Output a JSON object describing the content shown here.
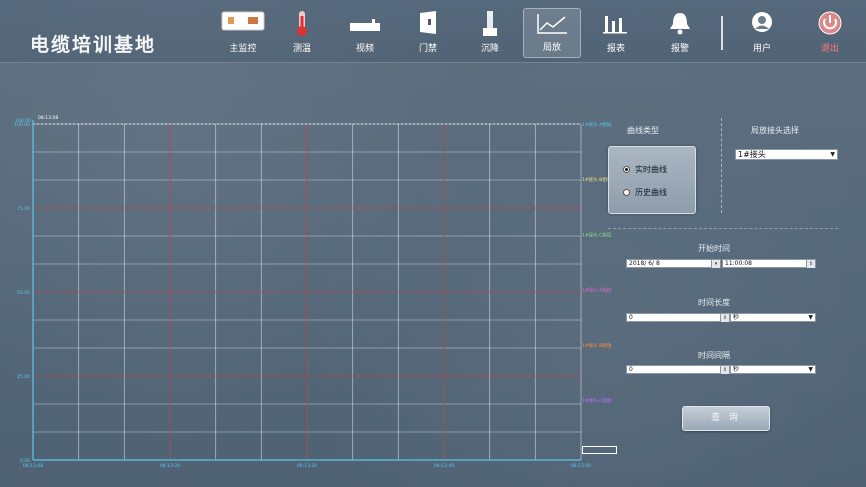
{
  "app": {
    "title": "电缆培训基地"
  },
  "nav": [
    {
      "id": "main",
      "label": "主监控",
      "icon": "monitor-icon"
    },
    {
      "id": "temp",
      "label": "测温",
      "icon": "thermometer-icon"
    },
    {
      "id": "video",
      "label": "视频",
      "icon": "camera-icon"
    },
    {
      "id": "door",
      "label": "门禁",
      "icon": "door-icon"
    },
    {
      "id": "settle",
      "label": "沉降",
      "icon": "settlement-icon"
    },
    {
      "id": "pd",
      "label": "局放",
      "icon": "line-chart-icon"
    },
    {
      "id": "report",
      "label": "报表",
      "icon": "bar-chart-icon"
    },
    {
      "id": "alarm",
      "label": "报警",
      "icon": "bell-icon"
    },
    {
      "id": "user",
      "label": "用户",
      "icon": "user-icon"
    },
    {
      "id": "exit",
      "label": "退出",
      "icon": "power-icon"
    }
  ],
  "active_nav": "pd",
  "panel": {
    "curve_type_label": "曲线类型",
    "realtime_label": "实时曲线",
    "history_label": "历史曲线",
    "connector_label": "局放接头选择",
    "connector_value": "1#接头",
    "start_time_label": "开始时间",
    "start_date_value": "2018/ 6/ 8",
    "start_time_value": "11:00:08",
    "duration_label": "时间长度",
    "duration_value": "0",
    "duration_unit": "秒",
    "interval_label": "时间间隔",
    "interval_value": "0",
    "interval_unit": "秒",
    "query_label": "查 询"
  },
  "colors": {
    "accent_grid": "#9c3a3a",
    "axis": "#5bc7e6"
  },
  "chart_data": {
    "type": "line",
    "y_ticks": [
      "100.00",
      "75.00",
      "50.00",
      "25.00",
      "0.00"
    ],
    "ylim": [
      0,
      100
    ],
    "top_axis_max": "100.00",
    "top_time": "08:13:08",
    "x_ticks": [
      "08:13:08",
      "08:13:20",
      "08:13:30",
      "08:13:40",
      "08:13:50"
    ],
    "series": [
      {
        "name": "1#接头-A相局放量",
        "color": "#5bc7e6",
        "values": []
      },
      {
        "name": "1#接头-B相局放量",
        "color": "#e8e28a",
        "values": []
      },
      {
        "name": "1#接头-C相局放量",
        "color": "#8ee08e",
        "values": []
      },
      {
        "name": "1#接头-A相放电次",
        "color": "#e066c8",
        "values": []
      },
      {
        "name": "1#接头-B相放电次",
        "color": "#ff8a3c",
        "values": []
      },
      {
        "name": "1#接头-C相放电次",
        "color": "#c070ff",
        "values": []
      }
    ]
  }
}
